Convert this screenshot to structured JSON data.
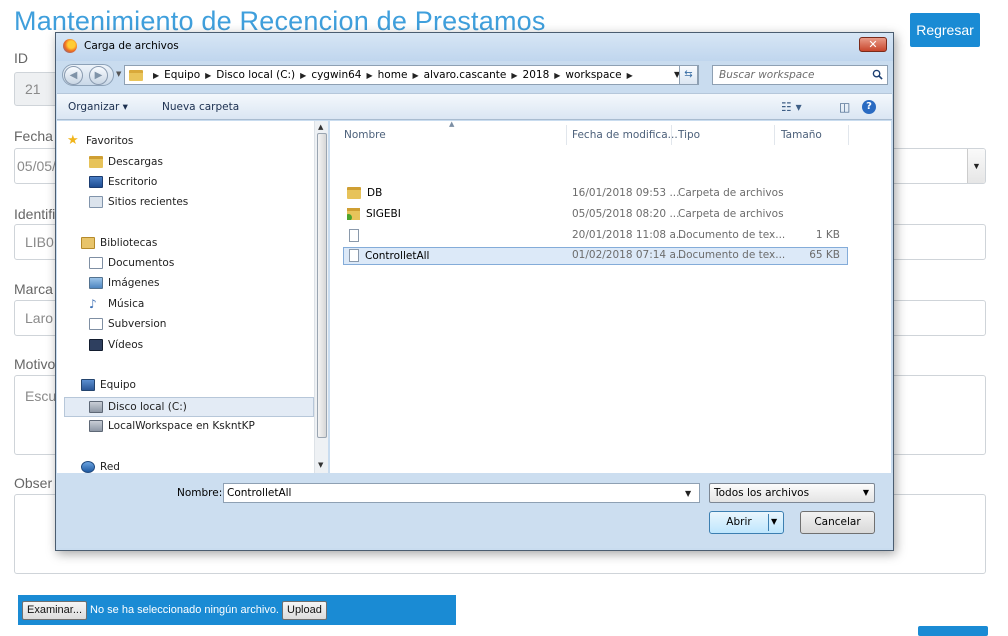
{
  "form": {
    "title": "Mantenimiento de Recencion de Prestamos",
    "back_label": "Regresar",
    "id_label": "ID",
    "id_value": "21",
    "fecha_label": "Fecha",
    "fecha_value": "05/05/",
    "identificador_label": "Identifi",
    "identificador_value": "LIB0",
    "marca_label": "Marca",
    "marca_value": "Laro",
    "motivo_label": "Motivo",
    "motivo_placeholder": "Escu",
    "observaciones_label": "Obser",
    "observaciones_value": "",
    "upload": {
      "browse_label": "Examinar...",
      "status_text": "No se ha seleccionado ningún archivo.",
      "upload_label": "Upload"
    }
  },
  "dialog": {
    "title": "Carga de archivos",
    "close_label": "✕",
    "breadcrumb": [
      "Equipo",
      "Disco local (C:)",
      "cygwin64",
      "home",
      "alvaro.cascante",
      "2018",
      "workspace"
    ],
    "search_placeholder": "Buscar workspace",
    "toolbar": {
      "organize_label": "Organizar ▾",
      "new_folder_label": "Nueva carpeta"
    },
    "nav": {
      "favorites": "Favoritos",
      "downloads": "Descargas",
      "desktop": "Escritorio",
      "recent": "Sitios recientes",
      "libraries": "Bibliotecas",
      "documents": "Documentos",
      "images": "Imágenes",
      "music": "Música",
      "subversion": "Subversion",
      "videos": "Vídeos",
      "computer": "Equipo",
      "local_disk": "Disco local (C:)",
      "local_workspace": "LocalWorkspace en KskntKP",
      "network": "Red"
    },
    "columns": {
      "name": "Nombre",
      "modified": "Fecha de modifica...",
      "type": "Tipo",
      "size": "Tamaño"
    },
    "files": [
      {
        "name": "DB",
        "modified": "16/01/2018 09:53 ...",
        "type": "Carpeta de archivos",
        "size": ""
      },
      {
        "name": "SIGEBI",
        "modified": "05/05/2018 08:20 ...",
        "type": "Carpeta de archivos",
        "size": ""
      },
      {
        "name": "",
        "modified": "20/01/2018 11:08 a...",
        "type": "Documento de tex...",
        "size": "1 KB"
      },
      {
        "name": "ControlletAll",
        "modified": "01/02/2018 07:14 a...",
        "type": "Documento de tex...",
        "size": "65 KB"
      }
    ],
    "filename_label": "Nombre:",
    "filename_value": "ControlletAll",
    "filter_label": "Todos los archivos",
    "open_label": "Abrir",
    "cancel_label": "Cancelar"
  }
}
